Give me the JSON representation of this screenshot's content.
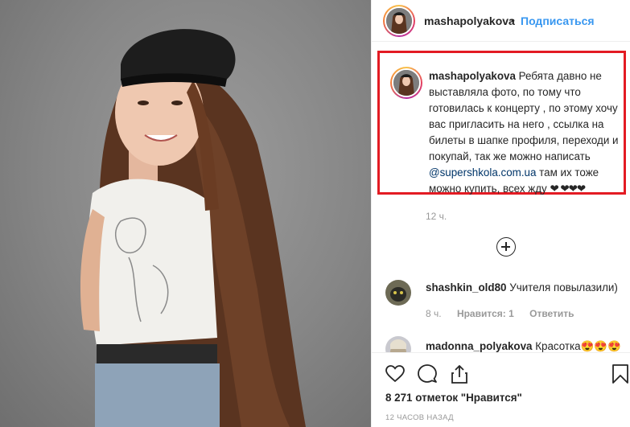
{
  "post": {
    "username": "mashapolyakova",
    "separator": "•",
    "follow_label": "Подписаться"
  },
  "caption": {
    "username": "mashapolyakova",
    "text_before": "Ребята давно не выставляла фото, по тому что готовилась к концерту , по этому хочу вас пригласить на него , ссылка на билеты в шапке профиля, переходи и покупай, так же можно написать",
    "mention": "@supershkola.com.ua",
    "text_after": "там их тоже можно купить, всех жду",
    "hearts": "❤ ❤❤❤",
    "time": "12 ч."
  },
  "comments": [
    {
      "username": "shashkin_old80",
      "text": "Учителя повылазили)",
      "time": "8 ч.",
      "likes_label": "Нравится: 1",
      "reply_label": "Ответить"
    },
    {
      "username": "madonna_polyakova",
      "text": "Красотка😍😍😍"
    }
  ],
  "likes_text": "8 271 отметок \"Нравится\"",
  "posted_time": "12 ЧАСОВ НАЗАД",
  "icons": [
    "heart-icon",
    "comment-icon",
    "share-icon",
    "bookmark-icon",
    "plus-circle-icon"
  ],
  "colors": {
    "follow": "#3897f0",
    "highlight_border": "#e31b23",
    "muted": "#999999",
    "mention": "#003569"
  }
}
